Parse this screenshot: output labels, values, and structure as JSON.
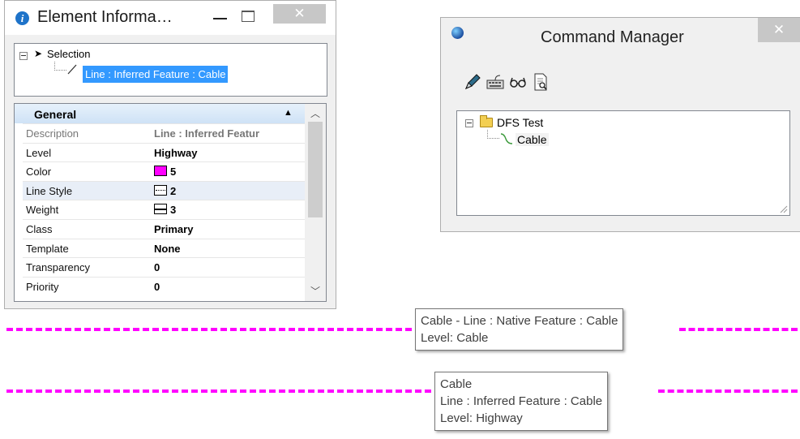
{
  "element_info": {
    "title": "Element Informa…",
    "tree": {
      "root_label": "Selection",
      "selected_item": "Line : Inferred Feature : Cable"
    },
    "section": "General",
    "properties": [
      {
        "key": "Description",
        "value": "Line : Inferred Featur",
        "dim": true
      },
      {
        "key": "Level",
        "value": "Highway"
      },
      {
        "key": "Color",
        "value": "5",
        "swatch": "#ff00ff"
      },
      {
        "key": "Line Style",
        "value": "2",
        "icon": "line-style-icon"
      },
      {
        "key": "Weight",
        "value": "3",
        "icon": "line-weight-icon"
      },
      {
        "key": "Class",
        "value": "Primary"
      },
      {
        "key": "Template",
        "value": "None"
      },
      {
        "key": "Transparency",
        "value": "0"
      },
      {
        "key": "Priority",
        "value": "0"
      }
    ]
  },
  "command_manager": {
    "title": "Command Manager",
    "toolbar_icons": [
      "pen-icon",
      "keyboard-icon",
      "glasses-icon",
      "document-search-icon"
    ],
    "tree": {
      "folder_label": "DFS Test",
      "child_label": "Cable"
    }
  },
  "tooltips": {
    "tip1": {
      "line1": "Cable - Line : Native Feature : Cable",
      "line2": "Level: Cable"
    },
    "tip2": {
      "line1": "Cable",
      "line2": "Line : Inferred Feature : Cable",
      "line3": "Level: Highway"
    }
  },
  "colors": {
    "accent_magenta": "#ff00ff",
    "selection_blue": "#3399ff"
  }
}
